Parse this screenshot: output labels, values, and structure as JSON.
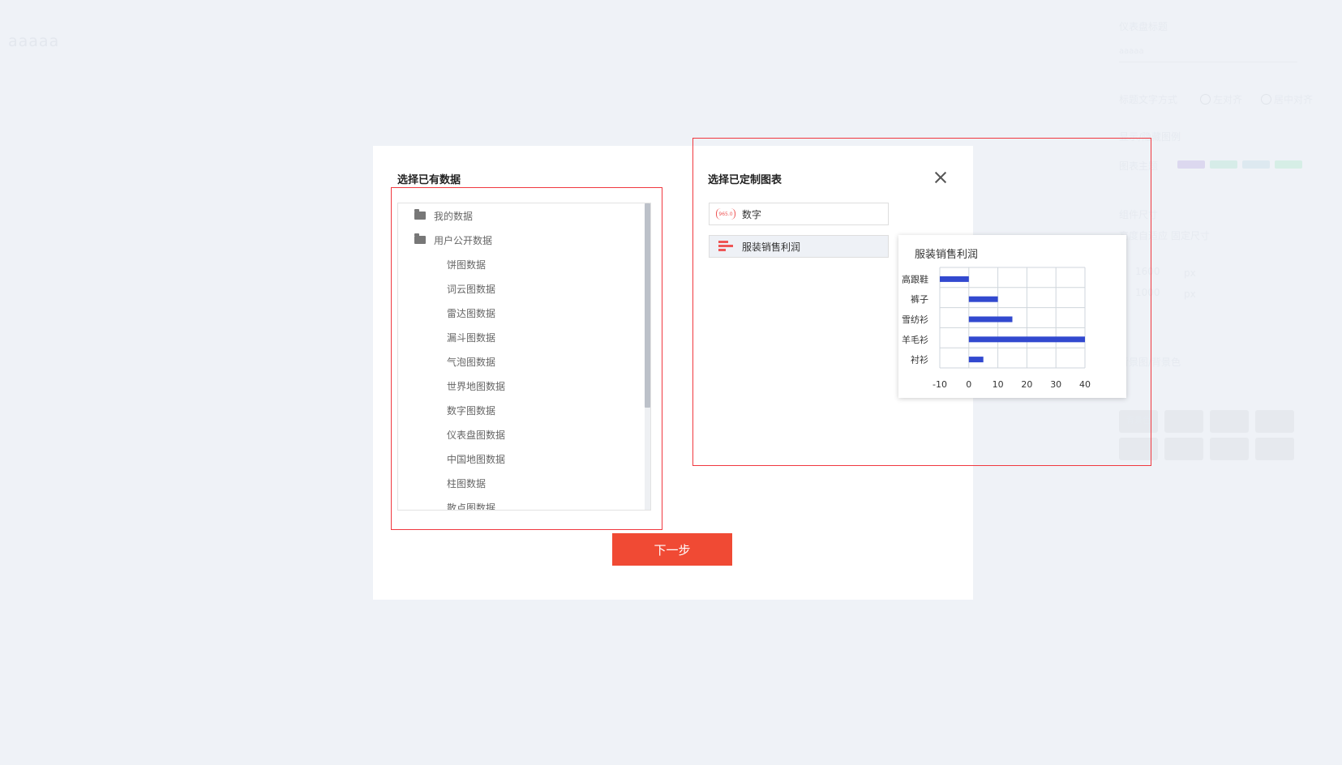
{
  "background": {
    "app_title": "aaaaa",
    "panel": {
      "label_1": "仪表盘标题",
      "input_value": "aaaaa",
      "label_2": "标题文字方式",
      "radio_1": "左对齐",
      "radio_2": "居中对齐",
      "label_3": "显示/隐藏图例",
      "label_4": "图表主题",
      "label_5": "组件尺寸",
      "label_6": "高度自适应 固定尺寸",
      "w_value": "1600",
      "w_unit": "px",
      "h_value": "1000",
      "h_unit": "px",
      "label_7": "背景图/背景色",
      "thumb_label": "背景色",
      "colors": [
        "#dcd8ef",
        "#d6ece8",
        "#dde9f0",
        "#d6eee6"
      ]
    }
  },
  "modal": {
    "data_section_title": "选择已有数据",
    "tree": [
      {
        "label": "我的数据",
        "folder": true
      },
      {
        "label": "用户公开数据",
        "folder": true
      },
      {
        "label": "饼图数据",
        "folder": false
      },
      {
        "label": "词云图数据",
        "folder": false
      },
      {
        "label": "雷达图数据",
        "folder": false
      },
      {
        "label": "漏斗图数据",
        "folder": false
      },
      {
        "label": "气泡图数据",
        "folder": false
      },
      {
        "label": "世界地图数据",
        "folder": false
      },
      {
        "label": "数字图数据",
        "folder": false
      },
      {
        "label": "仪表盘图数据",
        "folder": false
      },
      {
        "label": "中国地图数据",
        "folder": false
      },
      {
        "label": "柱图数据",
        "folder": false
      },
      {
        "label": "散点图数据",
        "folder": false
      }
    ],
    "next_button": "下一步",
    "chart_section_title": "选择已定制图表",
    "charts": [
      {
        "label": "数字",
        "icon": "number-chart-icon",
        "icon_text": "965.0"
      },
      {
        "label": "服装销售利润",
        "icon": "bar-chart-icon"
      }
    ],
    "accent_color": "#f04a34"
  },
  "chart_data": {
    "type": "bar",
    "orientation": "horizontal",
    "title": "服装销售利润",
    "categories": [
      "高跟鞋",
      "裤子",
      "雪纺衫",
      "羊毛衫",
      "衬衫"
    ],
    "values": [
      -10,
      10,
      15,
      40,
      5
    ],
    "xticks": [
      -10,
      0,
      10,
      20,
      30,
      40
    ],
    "xlim": [
      -10,
      40
    ],
    "grid": true,
    "bar_color": "#3249cf"
  }
}
